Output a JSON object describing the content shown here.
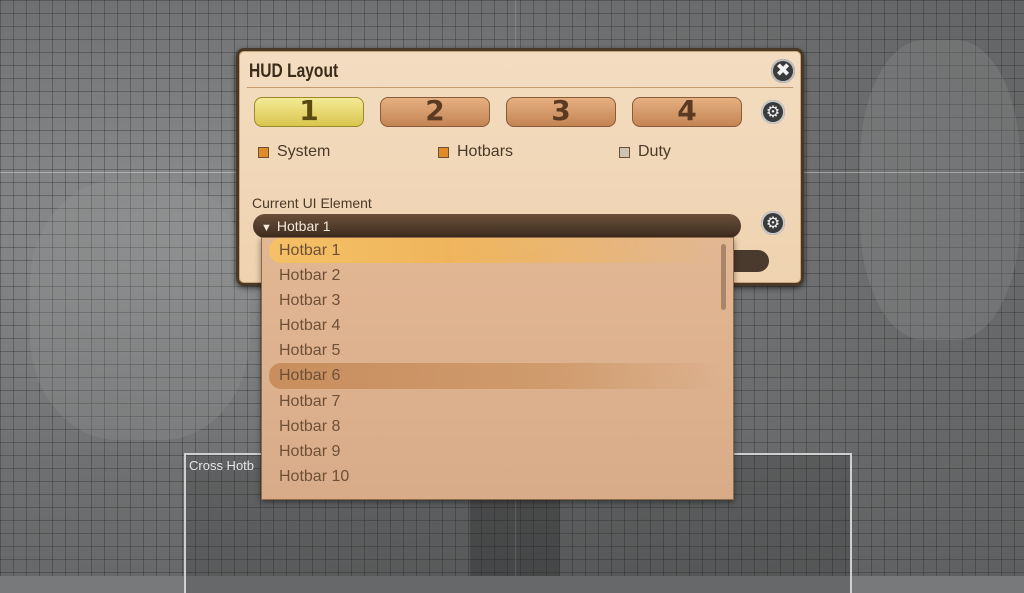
{
  "window": {
    "title": "HUD Layout",
    "close_icon": "close-icon"
  },
  "layout_slots": [
    {
      "label": "1",
      "active": true
    },
    {
      "label": "2",
      "active": false
    },
    {
      "label": "3",
      "active": false
    },
    {
      "label": "4",
      "active": false
    }
  ],
  "filters": [
    {
      "label": "System",
      "checked": true
    },
    {
      "label": "Hotbars",
      "checked": true
    },
    {
      "label": "Duty",
      "checked": false
    }
  ],
  "current_element": {
    "label": "Current UI Element",
    "value": "Hotbar 1"
  },
  "dropdown_options": [
    "Hotbar 1",
    "Hotbar 2",
    "Hotbar 3",
    "Hotbar 4",
    "Hotbar 5",
    "Hotbar 6",
    "Hotbar 7",
    "Hotbar 8",
    "Hotbar 9",
    "Hotbar 10"
  ],
  "dropdown_selected": "Hotbar 1",
  "dropdown_hovered": "Hotbar 6",
  "background_panel": {
    "label": "Cross Hotb"
  },
  "colors": {
    "accent_active": "#d9c64e",
    "checkbox_on": "#e08a2a",
    "window_bg": "#efd3b0"
  }
}
